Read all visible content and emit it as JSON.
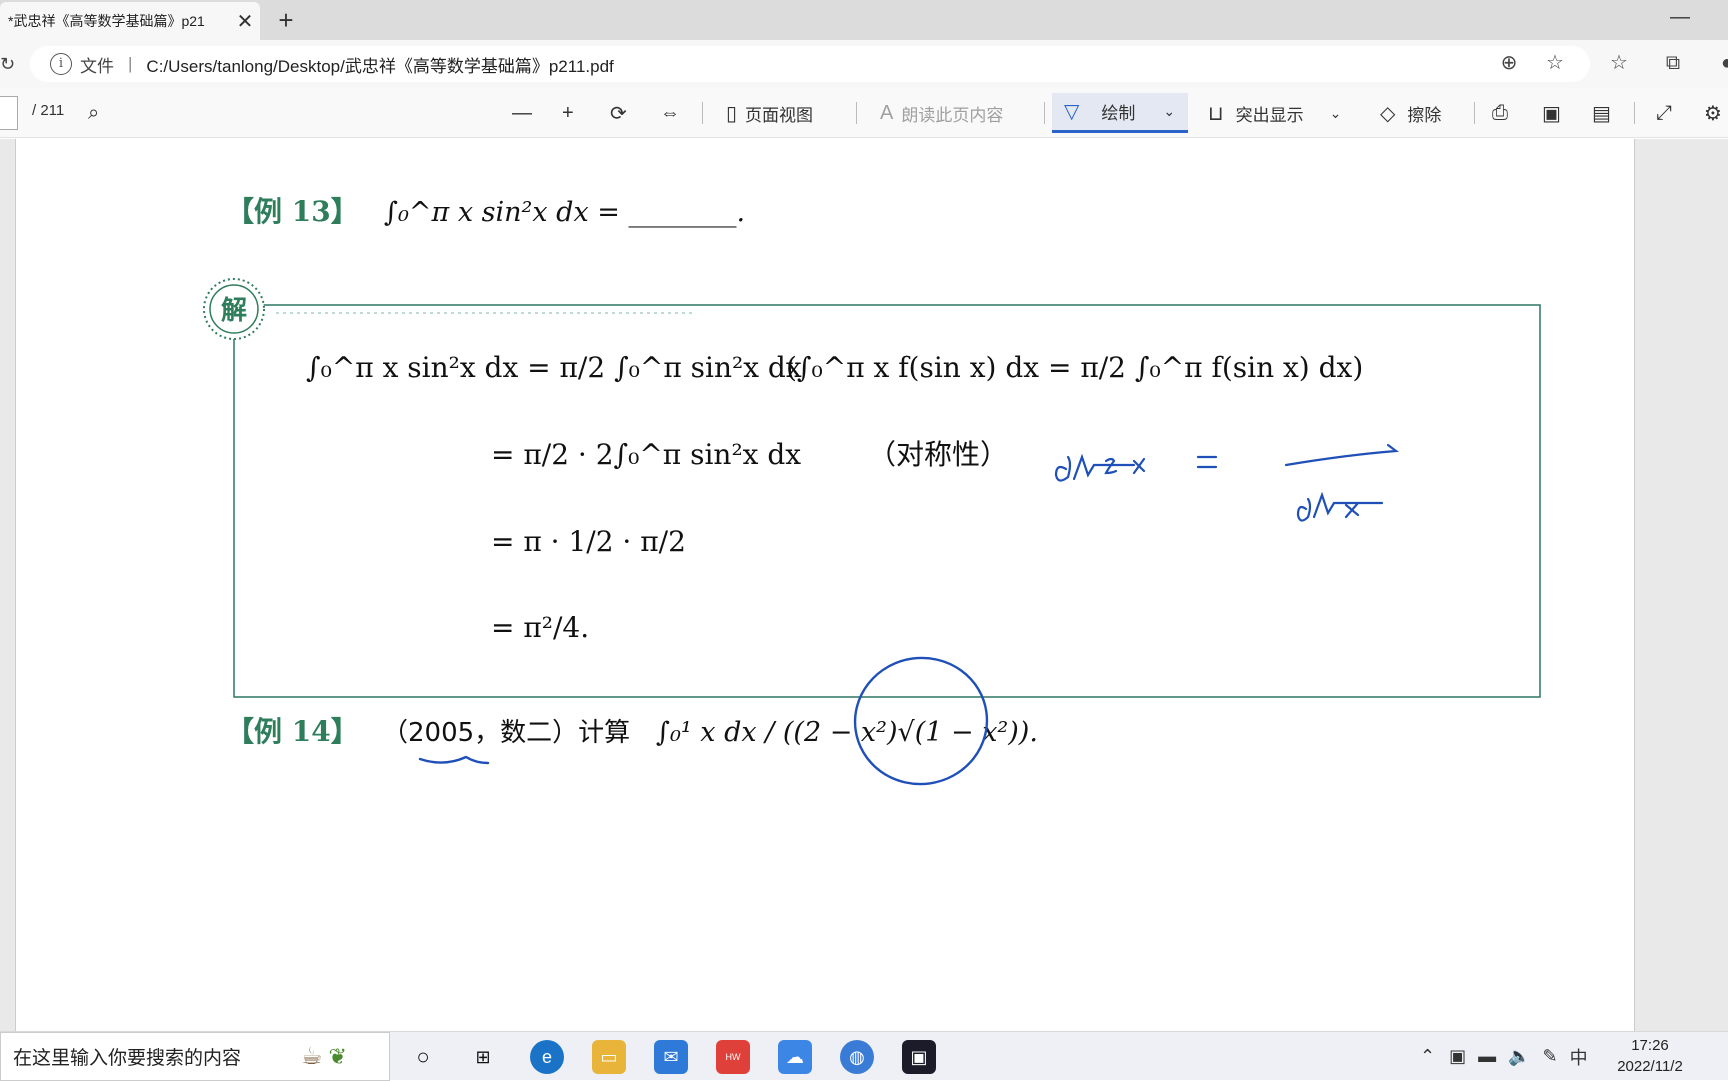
{
  "browser": {
    "tab_title": "*武忠祥《高等数学基础篇》p21",
    "tab_close": "✕",
    "new_tab": "+",
    "minimize": "—",
    "address_label": "文件",
    "address_url": "C:/Users/tanlong/Desktop/武忠祥《高等数学基础篇》p211.pdf"
  },
  "pdf_toolbar": {
    "page_total": "/ 211",
    "page_view_label": "页面视图",
    "read_aloud_label": "朗读此页内容",
    "draw_label": "绘制",
    "highlight_label": "突出显示",
    "erase_label": "擦除",
    "accent_color": "#2b64c8"
  },
  "document": {
    "example13_label": "【例 13】",
    "example13_problem": "∫₀^π x sin²x dx = ________.",
    "solution_badge": "解",
    "step1_lhs": "∫₀^π x sin²x dx = π/2 ∫₀^π sin²x dx",
    "step1_note": "(∫₀^π x f(sin x) dx = π/2 ∫₀^π f(sin x) dx)",
    "step2": "= π/2 · 2∫₀^π sin²x dx",
    "step2_note": "（对称性）",
    "step3": "= π · 1/2 · π/2",
    "step4": "= π²/4.",
    "example14_label": "【例 14】",
    "example14_source": "（2005，数二）计算",
    "example14_integral": "∫₀¹ x dx / ((2 − x²)√(1 − x²)).",
    "accent_green": "#2e7d5b",
    "ink_blue": "#1f4fb8"
  },
  "taskbar": {
    "search_placeholder": "在这里输入你要搜索的内容",
    "ime_label": "中",
    "time": "17:26",
    "date": "2022/11/2"
  }
}
